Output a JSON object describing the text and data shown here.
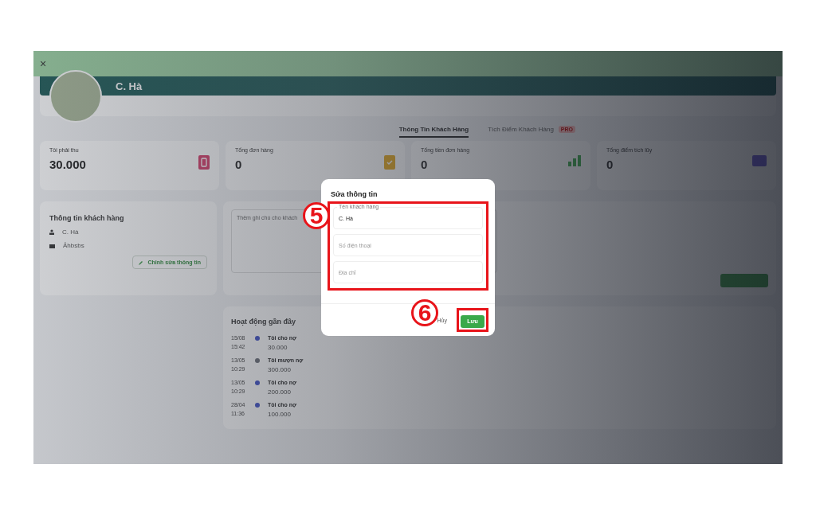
{
  "header": {
    "close": "×"
  },
  "profile": {
    "name": "C. Hà",
    "tabs": [
      {
        "label": "Thông Tin Khách Hàng",
        "selected": true
      },
      {
        "label": "Tích Điểm Khách Hàng",
        "selected": false,
        "badge": "PRO"
      }
    ]
  },
  "stats": [
    {
      "label": "Tôi phải thu",
      "value": "30.000"
    },
    {
      "label": "Tổng đơn hàng",
      "value": "0"
    },
    {
      "label": "Tổng tiền đơn hàng",
      "value": "0"
    },
    {
      "label": "Tổng điểm tích lũy",
      "value": "0"
    }
  ],
  "customer_info": {
    "title": "Thông tin khách hàng",
    "name": "C. Hà",
    "group": "Ảhbsbs",
    "edit_button": "Chỉnh sửa thông tin"
  },
  "note": {
    "placeholder": "Thêm ghi chú cho khách"
  },
  "activity": {
    "title": "Hoạt động gần đây",
    "items": [
      {
        "date": "15/08",
        "time": "15:42",
        "title": "Tôi cho nợ",
        "amount": "30.000",
        "kind": "lend"
      },
      {
        "date": "13/05",
        "time": "10:29",
        "title": "Tôi mượn nợ",
        "amount": "300.000",
        "kind": "borrow"
      },
      {
        "date": "13/05",
        "time": "10:29",
        "title": "Tôi cho nợ",
        "amount": "200.000",
        "kind": "lend"
      },
      {
        "date": "28/04",
        "time": "11:36",
        "title": "Tôi cho nợ",
        "amount": "100.000",
        "kind": "lend"
      }
    ]
  },
  "dialog": {
    "title": "Sửa thông tin",
    "fields": [
      {
        "label": "Tên khách hàng",
        "value": "C. Hà"
      },
      {
        "placeholder": "Số điện thoại"
      },
      {
        "placeholder": "Địa chỉ"
      }
    ],
    "cancel": "Hủy",
    "save": "Lưu"
  },
  "annotations": [
    {
      "number": "5"
    },
    {
      "number": "6"
    }
  ]
}
